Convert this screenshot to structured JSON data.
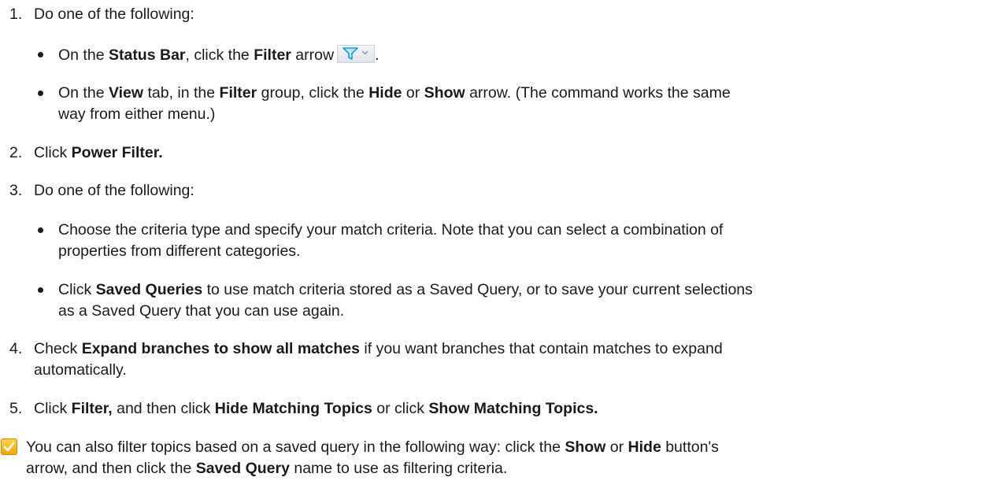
{
  "step1": {
    "num": "1.",
    "text": "Do one of the following:",
    "bullet1": {
      "pre": "On the ",
      "b1": "Status Bar",
      "mid": ", click the ",
      "b2": "Filter",
      "post": " arrow",
      "end": ".",
      "icon": "filter-funnel-icon"
    },
    "bullet2": {
      "pre": "On the ",
      "b1": "View",
      "mid1": " tab, in the ",
      "b2": "Filter",
      "mid2": " group, click the ",
      "b3": "Hide",
      "mid3": " or ",
      "b4": "Show",
      "post": " arrow. (The command works the same",
      "line2": "way from either menu.)"
    }
  },
  "step2": {
    "num": "2.",
    "pre": "Click ",
    "b1": "Power Filter."
  },
  "step3": {
    "num": "3.",
    "text": "Do one of the following:",
    "bullet1": {
      "line1": "Choose the criteria type and specify your match criteria. Note that you can select a combination of",
      "line2": "properties from different categories."
    },
    "bullet2": {
      "pre": "Click ",
      "b1": "Saved Queries",
      "post": " to use match criteria stored as a Saved Query, or to save your current selections",
      "line2": "as a Saved Query that you can use again."
    }
  },
  "step4": {
    "num": "4.",
    "pre": "Check ",
    "b1": "Expand branches to show all matches",
    "post": " if you want branches that contain matches to expand",
    "line2": "automatically."
  },
  "step5": {
    "num": "5.",
    "pre": "Click ",
    "b1": "Filter,",
    "mid1": " and then click ",
    "b2": "Hide Matching Topics",
    "mid2": " or click ",
    "b3": "Show Matching Topics."
  },
  "tip": {
    "icon": "checkmark-tip-icon",
    "pre": "You can also filter topics based on a saved query in the following way: click the ",
    "b1": "Show",
    "mid1": " or ",
    "b2": "Hide",
    "post": " button's",
    "line2_pre": "arrow, and then click the ",
    "line2_b": "Saved Query",
    "line2_post": " name to use as filtering criteria."
  }
}
